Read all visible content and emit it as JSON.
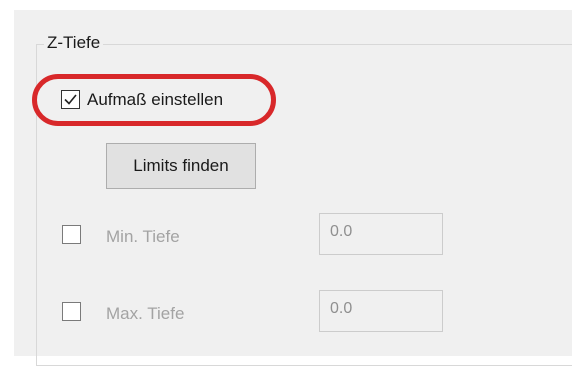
{
  "group": {
    "title": "Z-Tiefe"
  },
  "allowance": {
    "label": "Aufmaß einstellen",
    "checked": true,
    "highlight_color": "#d8282a"
  },
  "limits_button": {
    "label": "Limits finden"
  },
  "min_depth": {
    "label": "Min. Tiefe",
    "checked": false,
    "enabled": false,
    "value": "0.0"
  },
  "max_depth": {
    "label": "Max. Tiefe",
    "checked": false,
    "enabled": false,
    "value": "0.0"
  }
}
